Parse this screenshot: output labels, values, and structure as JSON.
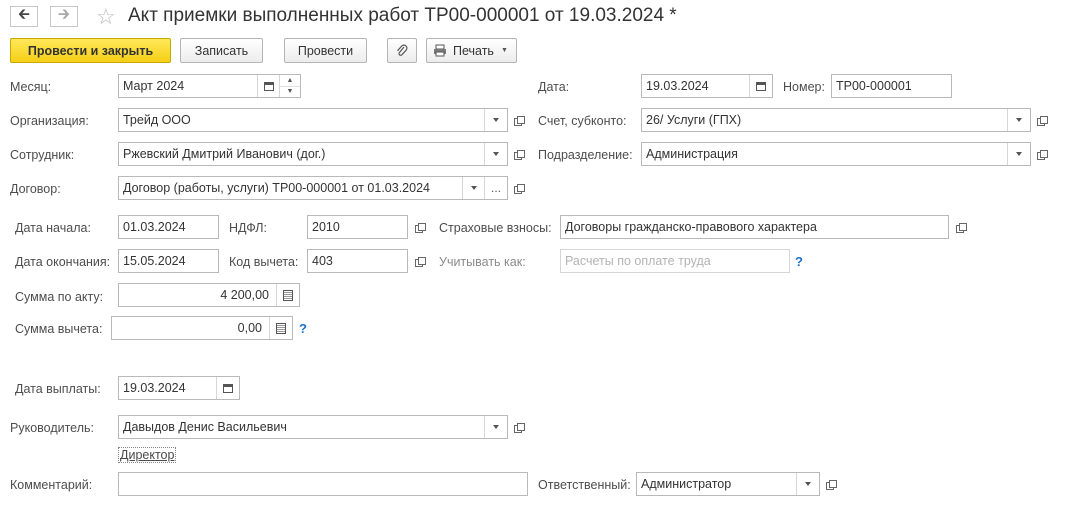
{
  "window": {
    "title": "Акт приемки выполненных работ ТР00-000001 от 19.03.2024 *"
  },
  "toolbar": {
    "post_close_label": "Провести и закрыть",
    "save_label": "Записать",
    "post_label": "Провести",
    "print_label": "Печать"
  },
  "fields": {
    "month": {
      "label": "Месяц:",
      "value": "Март 2024"
    },
    "date": {
      "label": "Дата:",
      "value": "19.03.2024"
    },
    "number": {
      "label": "Номер:",
      "value": "ТР00-000001"
    },
    "organization": {
      "label": "Организация:",
      "value": "Трейд ООО"
    },
    "account": {
      "label": "Счет, субконто:",
      "value": "26/ Услуги (ГПХ)"
    },
    "employee": {
      "label": "Сотрудник:",
      "value": "Ржевский Дмитрий Иванович (дог.)"
    },
    "department": {
      "label": "Подразделение:",
      "value": "Администрация"
    },
    "contract": {
      "label": "Договор:",
      "value": "Договор (работы, услуги) ТР00-000001 от 01.03.2024"
    },
    "start_date": {
      "label": "Дата начала:",
      "value": "01.03.2024"
    },
    "ndfl": {
      "label": "НДФЛ:",
      "value": "2010"
    },
    "insurance": {
      "label": "Страховые взносы:",
      "value": "Договоры гражданско-правового характера"
    },
    "end_date": {
      "label": "Дата окончания:",
      "value": "15.05.2024"
    },
    "deduction_code": {
      "label": "Код вычета:",
      "value": "403"
    },
    "account_as": {
      "label": "Учитывать как:",
      "placeholder": "Расчеты по оплате труда",
      "help": "?"
    },
    "act_sum": {
      "label": "Сумма по акту:",
      "value": "4 200,00"
    },
    "deduction_sum": {
      "label": "Сумма вычета:",
      "value": "0,00",
      "help": "?"
    },
    "pay_date": {
      "label": "Дата выплаты:",
      "value": "19.03.2024"
    },
    "manager": {
      "label": "Руководитель:",
      "value": "Давыдов Денис Васильевич",
      "position": "Директор"
    },
    "comment": {
      "label": "Комментарий:",
      "value": ""
    },
    "responsible": {
      "label": "Ответственный:",
      "value": "Администратор"
    }
  },
  "colors": {
    "primary_button": "#f5cf16",
    "help": "#1e73c8",
    "border": "#b9b9b9"
  }
}
